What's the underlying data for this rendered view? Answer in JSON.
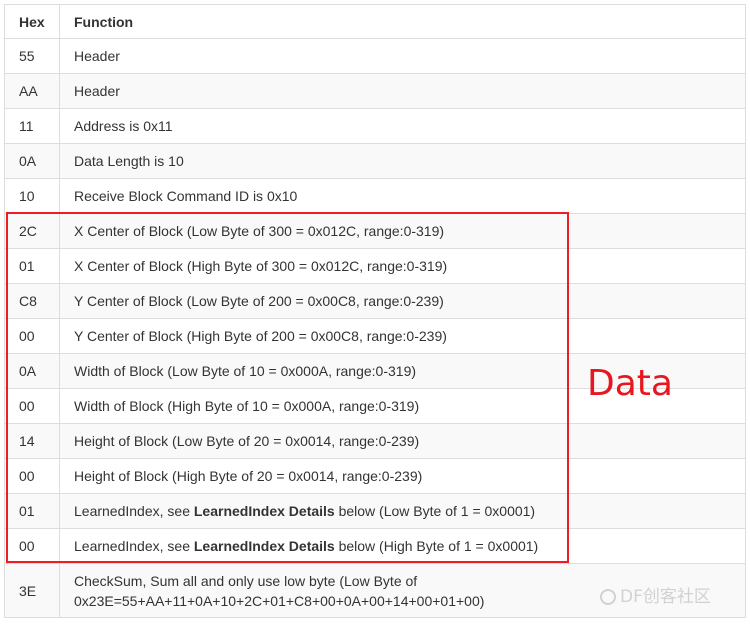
{
  "table": {
    "headers": [
      "Hex",
      "Function"
    ],
    "rows": [
      {
        "hex": "55",
        "function": "Header"
      },
      {
        "hex": "AA",
        "function": "Header"
      },
      {
        "hex": "11",
        "function": "Address is 0x11"
      },
      {
        "hex": "0A",
        "function": "Data Length is 10"
      },
      {
        "hex": "10",
        "function": "Receive Block Command ID is 0x10"
      },
      {
        "hex": "2C",
        "function": "X Center of Block (Low Byte of 300 = 0x012C, range:0-319)"
      },
      {
        "hex": "01",
        "function": "X Center of Block (High Byte of 300 = 0x012C, range:0-319)"
      },
      {
        "hex": "C8",
        "function": "Y Center of Block (Low Byte of 200 = 0x00C8, range:0-239)"
      },
      {
        "hex": "00",
        "function": "Y Center of Block (High Byte of 200 = 0x00C8, range:0-239)"
      },
      {
        "hex": "0A",
        "function": "Width of Block (Low Byte of 10 = 0x000A, range:0-319)"
      },
      {
        "hex": "00",
        "function": "Width of Block (High Byte of 10 = 0x000A, range:0-319)"
      },
      {
        "hex": "14",
        "function": "Height of Block (Low Byte of 20 = 0x0014, range:0-239)"
      },
      {
        "hex": "00",
        "function": "Height of Block (High Byte of 20 = 0x0014, range:0-239)"
      },
      {
        "hex": "01",
        "function_pre": "LearnedIndex, see ",
        "function_bold": "LearnedIndex Details",
        "function_post": " below (Low Byte of 1 = 0x0001)"
      },
      {
        "hex": "00",
        "function_pre": "LearnedIndex, see ",
        "function_bold": "LearnedIndex Details",
        "function_post": " below (High Byte of 1 = 0x0001)"
      },
      {
        "hex": "3E",
        "function_line1": "CheckSum, Sum all and only use low byte (Low Byte of",
        "function_line2": "0x23E=55+AA+11+0A+10+2C+01+C8+00+0A+00+14+00+01+00)"
      }
    ]
  },
  "annotation": {
    "label": "Data",
    "color": "#ee1c24"
  },
  "watermark": {
    "text": "DF创客社区"
  }
}
